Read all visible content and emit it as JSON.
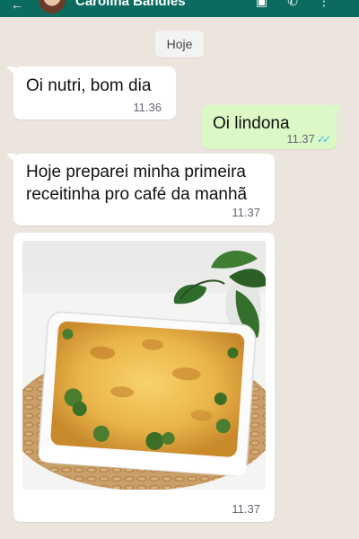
{
  "header": {
    "contact_name": "Carolina Bandles",
    "back_icon": "arrow-left-icon",
    "actions": [
      "video-call-icon",
      "phone-icon",
      "more-vert-icon"
    ]
  },
  "chat": {
    "date_chip": "Hoje",
    "messages": [
      {
        "direction": "in",
        "text": "Oi nutri, bom dia",
        "time": "11.36"
      },
      {
        "direction": "out",
        "text": "Oi lindona",
        "time": "11.37",
        "status": "read"
      },
      {
        "direction": "in",
        "text": "Hoje preparei minha primeira receitinha pro café da manhã",
        "time": "11.37"
      },
      {
        "direction": "in",
        "type": "image",
        "image": "broccoli-cheese-casserole-photo",
        "time": "11.37"
      }
    ]
  },
  "colors": {
    "header": "#0b6b5f",
    "chat_bg": "#ece5dd",
    "bubble_in": "#ffffff",
    "bubble_out": "#dcf8c6",
    "read_ticks": "#34b7f1"
  }
}
